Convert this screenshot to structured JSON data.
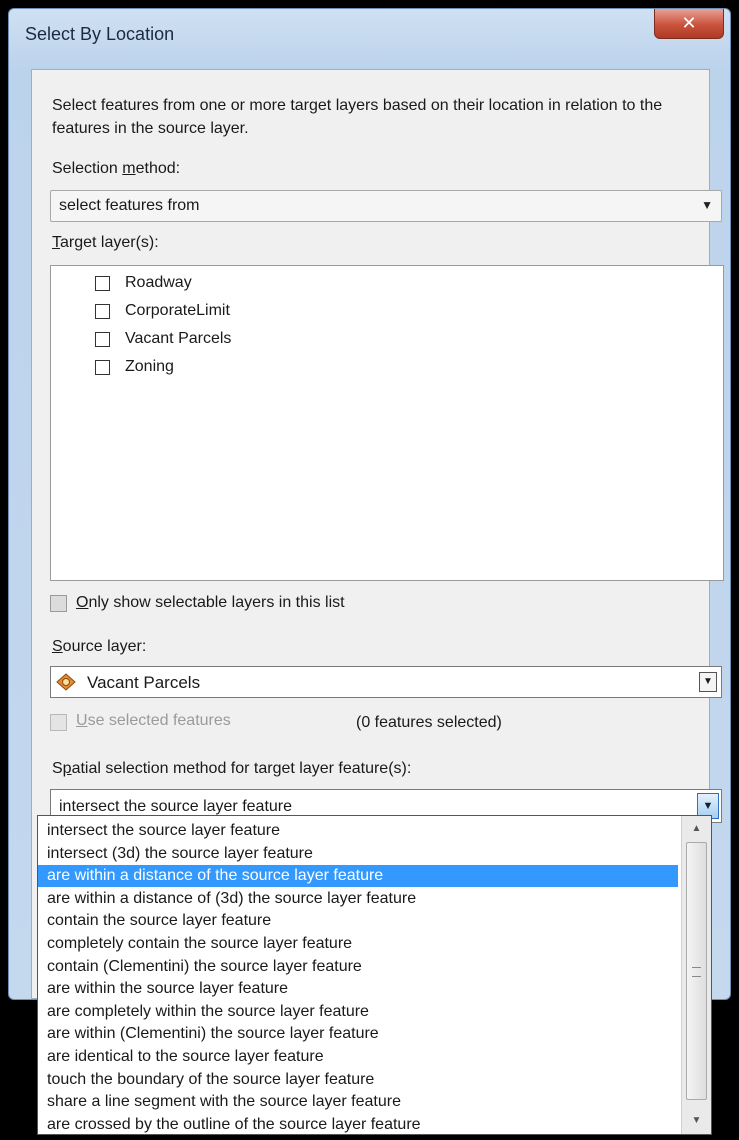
{
  "window": {
    "title": "Select By Location",
    "close_glyph": "✕"
  },
  "description": "Select features from one or more target layers based on their location in relation to the features in the source layer.",
  "selection_method": {
    "label_pre": "Selection ",
    "label_ul": "m",
    "label_post": "ethod:",
    "value": "select features from"
  },
  "target_layers": {
    "label_ul": "T",
    "label_post": "arget layer(s):",
    "items": [
      {
        "label": "Roadway",
        "checked": false
      },
      {
        "label": "CorporateLimit",
        "checked": false
      },
      {
        "label": "Vacant Parcels",
        "checked": false
      },
      {
        "label": "Zoning",
        "checked": false
      }
    ]
  },
  "only_selectable": {
    "label_ul": "O",
    "label_post": "nly show selectable layers in this list"
  },
  "source_layer": {
    "label_ul": "S",
    "label_post": "ource layer:",
    "value": "Vacant Parcels",
    "icon": "polygon-layer-icon"
  },
  "use_selected": {
    "label_ul": "U",
    "label_post": "se selected features",
    "count_text": "(0 features selected)"
  },
  "spatial_method": {
    "label_pre": "S",
    "label_ul": "p",
    "label_post": "atial selection method for target layer feature(s):",
    "value": "intersect the source layer feature",
    "selected_index": 2,
    "options": [
      "intersect the source layer feature",
      "intersect (3d) the source layer feature",
      "are within a distance of the source layer feature",
      "are within a distance of (3d) the source layer feature",
      "contain the source layer feature",
      "completely contain the source layer feature",
      "contain (Clementini) the source layer feature",
      "are within the source layer feature",
      "are completely within the source layer feature",
      "are within (Clementini) the source layer feature",
      "are identical to the source layer feature",
      "touch the boundary of the source layer feature",
      "share a line segment with the source layer feature",
      "are crossed by the outline of the source layer feature"
    ]
  },
  "colors": {
    "selection_highlight": "#3399ff",
    "close_button": "#c9523d",
    "window_frame": "#bcd3ec"
  }
}
